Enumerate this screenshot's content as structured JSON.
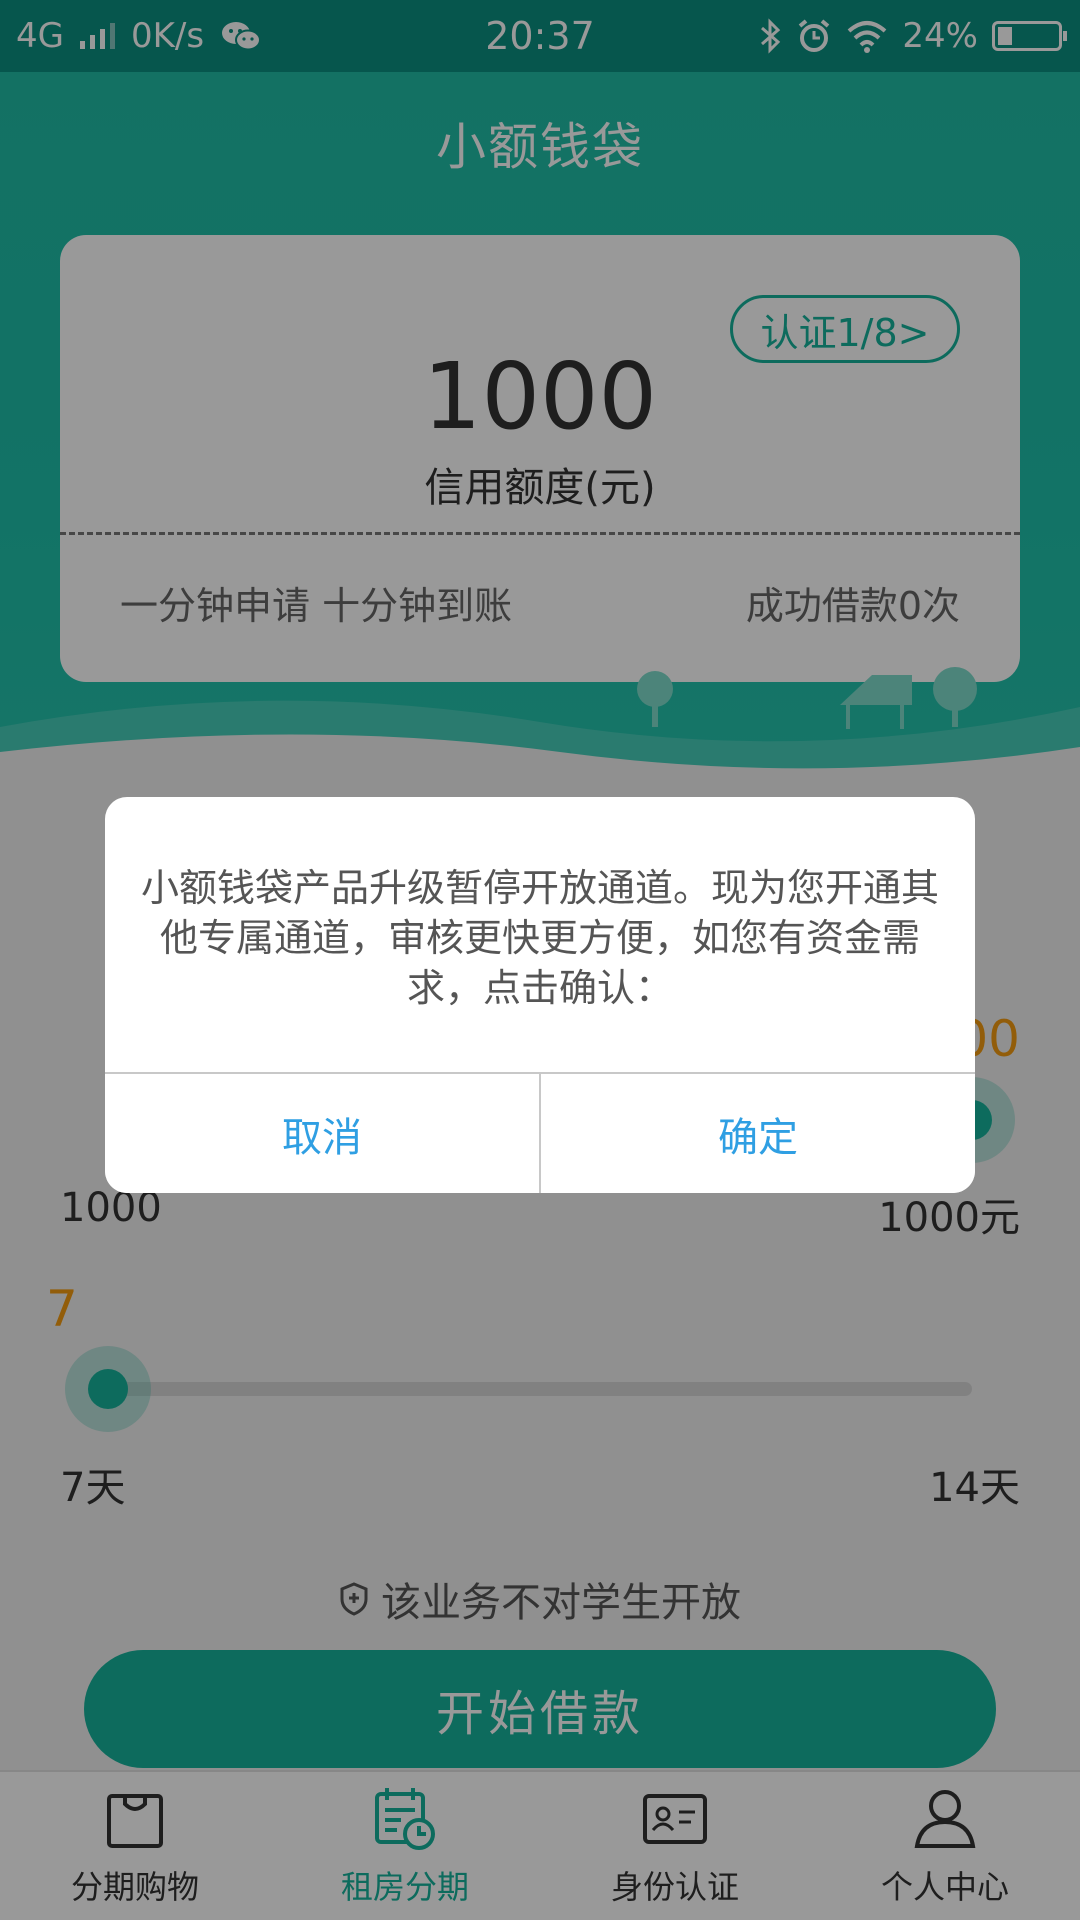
{
  "status_bar": {
    "network": "4G",
    "speed": "0K/s",
    "time": "20:37",
    "battery_percent": "24%",
    "battery_level": 0.24
  },
  "header": {
    "title": "小额钱袋",
    "auth_badge": "认证1/8>",
    "credit_amount": "1000",
    "credit_label": "信用额度(元)",
    "slogan": "一分钟申请 十分钟到账",
    "loan_count": "成功借款0次"
  },
  "amount_slider": {
    "value": "1000",
    "min_label": "1000",
    "max_label": "1000元",
    "fraction": 1.0
  },
  "days_slider": {
    "value": "7",
    "min_label": "7天",
    "max_label": "14天",
    "fraction": 0.0
  },
  "student_note": "该业务不对学生开放",
  "start_button": "开始借款",
  "bottom_nav": {
    "items": [
      {
        "label": "分期购物",
        "icon": "shopping-bag-icon"
      },
      {
        "label": "租房分期",
        "icon": "calendar-clock-icon",
        "active": true
      },
      {
        "label": "身份认证",
        "icon": "id-card-icon"
      },
      {
        "label": "个人中心",
        "icon": "person-icon"
      }
    ]
  },
  "dialog": {
    "message": "小额钱袋产品升级暂停开放通道。现为您开通其他专属通道，审核更快更方便，如您有资金需求，点击确认：",
    "cancel": "取消",
    "confirm": "确定"
  },
  "colors": {
    "accent": "#16b39c",
    "value_orange": "#f39c12",
    "dialog_button": "#2f9fe3"
  }
}
